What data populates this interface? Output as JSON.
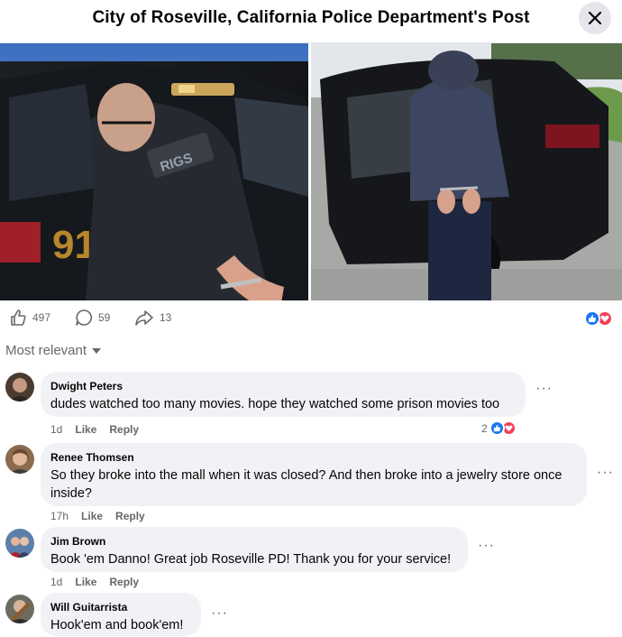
{
  "header": {
    "title": "City of Roseville, California Police Department's Post"
  },
  "photo_left": {
    "car_unit_number": "91",
    "patch_text": "RIGS"
  },
  "stats": {
    "likes": "497",
    "comments": "59",
    "shares": "13"
  },
  "sort": {
    "label": "Most relevant"
  },
  "comments": [
    {
      "author": "Dwight Peters",
      "text": "dudes watched too many movies. hope they watched some prison movies too",
      "time": "1d",
      "like_label": "Like",
      "reply_label": "Reply",
      "reaction_count": "2"
    },
    {
      "author": "Renee Thomsen",
      "text": "So they broke into the mall when it was closed? And then broke into a jewelry store once inside?",
      "time": "17h",
      "like_label": "Like",
      "reply_label": "Reply"
    },
    {
      "author": "Jim Brown",
      "text": "Book 'em Danno! Great job Roseville PD! Thank you for your service!",
      "time": "1d",
      "like_label": "Like",
      "reply_label": "Reply"
    },
    {
      "author": "Will Guitarrista",
      "text": "Hook'em and book'em!"
    }
  ],
  "colors": {
    "like_blue": "#1877f2",
    "love_red": "#f33e58",
    "bubble_gray": "#f0f2f5",
    "meta_gray": "#65676b"
  }
}
